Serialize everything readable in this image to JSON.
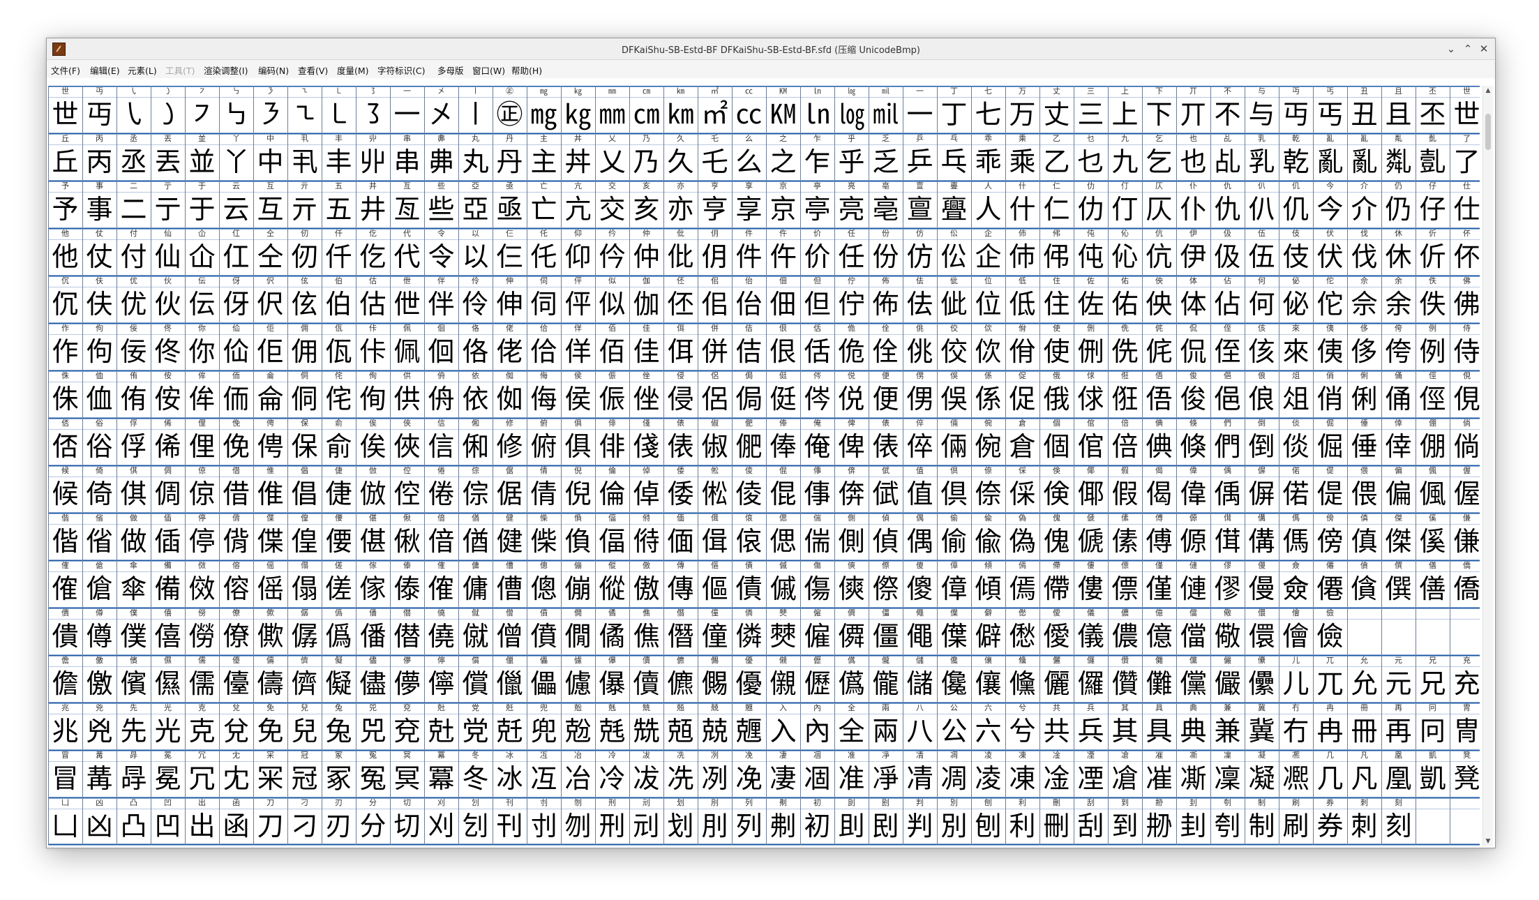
{
  "window": {
    "title": "DFKaiShu-SB-Estd-BF  DFKaiShu-SB-Estd-BF.sfd (压缩 UnicodeBmp)",
    "controls": {
      "minimize": "⌄",
      "maximize": "⌃",
      "close": "✕"
    }
  },
  "menubar": {
    "items": [
      "文件(F)",
      "编辑(E)",
      "元素(L)",
      "工具(T)",
      "渲染调整(I)",
      "编码(N)",
      "查看(V)",
      "度量(M)",
      "字符标识(C)",
      "多母版",
      "窗口(W)",
      "帮助(H)"
    ]
  },
  "grid": {
    "columns": 42,
    "line_color": "#1b57a6",
    "rows": [
      [
        "世",
        "丏",
        "㇂",
        "㇁",
        "㇇",
        "㇉",
        "㇋",
        "㇍",
        "㇄",
        "㇌",
        "一",
        "㐅",
        "㇑",
        "㊣",
        "㎎",
        "㎏",
        "㎜",
        "㎝",
        "㎞",
        "㎡",
        "㏄",
        "㏎",
        "㏑",
        "㏒",
        "㏕",
        "一",
        "丁",
        "七",
        "万",
        "丈",
        "三",
        "上",
        "下",
        "丌",
        "不",
        "与",
        "丏",
        "丐",
        "丑",
        "且",
        "丕",
        "世"
      ],
      [
        "丘",
        "丙",
        "丞",
        "丟",
        "並",
        "丫",
        "中",
        "丮",
        "丰",
        "丱",
        "串",
        "丳",
        "丸",
        "丹",
        "主",
        "丼",
        "乂",
        "乃",
        "久",
        "乇",
        "么",
        "之",
        "乍",
        "乎",
        "乏",
        "乒",
        "乓",
        "乖",
        "乘",
        "乙",
        "乜",
        "九",
        "乞",
        "也",
        "乩",
        "乳",
        "乾",
        "亂",
        "亂",
        "亃",
        "亄",
        "了"
      ],
      [
        "予",
        "事",
        "二",
        "亍",
        "于",
        "云",
        "互",
        "亓",
        "五",
        "井",
        "亙",
        "些",
        "亞",
        "亟",
        "亡",
        "亢",
        "交",
        "亥",
        "亦",
        "亨",
        "享",
        "京",
        "亭",
        "亮",
        "亳",
        "亶",
        "亹",
        "人",
        "什",
        "仁",
        "仂",
        "仃",
        "仄",
        "仆",
        "仇",
        "仈",
        "仉",
        "今",
        "介",
        "仍",
        "仔",
        "仕"
      ],
      [
        "他",
        "仗",
        "付",
        "仙",
        "仚",
        "仜",
        "仝",
        "仞",
        "仟",
        "仡",
        "代",
        "令",
        "以",
        "仨",
        "仛",
        "仰",
        "仱",
        "仲",
        "仳",
        "仴",
        "件",
        "仵",
        "价",
        "任",
        "份",
        "仿",
        "伀",
        "企",
        "伂",
        "伄",
        "伅",
        "伈",
        "伉",
        "伊",
        "伋",
        "伍",
        "伎",
        "伏",
        "伐",
        "休",
        "伒",
        "伓"
      ],
      [
        "伔",
        "伕",
        "优",
        "伙",
        "伝",
        "伢",
        "伬",
        "伭",
        "伯",
        "估",
        "伳",
        "伴",
        "伶",
        "伸",
        "伺",
        "伻",
        "似",
        "伽",
        "伾",
        "佀",
        "佁",
        "佃",
        "但",
        "佇",
        "佈",
        "佉",
        "佌",
        "位",
        "低",
        "住",
        "佐",
        "佑",
        "佒",
        "体",
        "佔",
        "何",
        "佖",
        "佗",
        "佘",
        "余",
        "佚",
        "佛"
      ],
      [
        "作",
        "佝",
        "佞",
        "佟",
        "你",
        "佡",
        "佢",
        "佣",
        "佤",
        "佧",
        "佩",
        "佪",
        "佫",
        "佬",
        "佮",
        "佯",
        "佰",
        "佳",
        "佴",
        "併",
        "佶",
        "佷",
        "佸",
        "佹",
        "佺",
        "佻",
        "佼",
        "佽",
        "佾",
        "使",
        "侀",
        "侁",
        "侂",
        "侃",
        "侄",
        "侅",
        "來",
        "侇",
        "侈",
        "侉",
        "例",
        "侍"
      ],
      [
        "侏",
        "侐",
        "侑",
        "侒",
        "侔",
        "侕",
        "侖",
        "侗",
        "侘",
        "侚",
        "供",
        "侜",
        "依",
        "侞",
        "侮",
        "侯",
        "侲",
        "侳",
        "侵",
        "侶",
        "侷",
        "侹",
        "侺",
        "侻",
        "便",
        "侽",
        "俁",
        "係",
        "促",
        "俄",
        "俅",
        "俇",
        "俉",
        "俊",
        "俋",
        "俍",
        "俎",
        "俏",
        "俐",
        "俑",
        "俓",
        "俔"
      ],
      [
        "俖",
        "俗",
        "俘",
        "俙",
        "俚",
        "俛",
        "俜",
        "保",
        "俞",
        "俟",
        "俠",
        "信",
        "俰",
        "修",
        "俯",
        "俱",
        "俳",
        "俴",
        "俵",
        "俶",
        "俷",
        "俸",
        "俺",
        "俾",
        "俵",
        "倅",
        "倆",
        "倇",
        "倉",
        "個",
        "倌",
        "倍",
        "倎",
        "倏",
        "們",
        "倒",
        "倓",
        "倔",
        "倕",
        "倖",
        "倗",
        "倘"
      ],
      [
        "候",
        "倚",
        "倛",
        "倜",
        "倞",
        "借",
        "倠",
        "倡",
        "倢",
        "倣",
        "倥",
        "倦",
        "倧",
        "倨",
        "倩",
        "倪",
        "倫",
        "倬",
        "倭",
        "倯",
        "倰",
        "倱",
        "倳",
        "倴",
        "倵",
        "值",
        "倶",
        "倷",
        "倸",
        "倹",
        "倻",
        "假",
        "偈",
        "偉",
        "偊",
        "偋",
        "偌",
        "偍",
        "偎",
        "偏",
        "偑",
        "偓"
      ],
      [
        "偕",
        "偗",
        "做",
        "偛",
        "停",
        "偝",
        "偞",
        "偟",
        "偠",
        "偡",
        "偢",
        "偣",
        "偤",
        "健",
        "偨",
        "偩",
        "偪",
        "偫",
        "偭",
        "偮",
        "偯",
        "偲",
        "偳",
        "側",
        "偵",
        "偶",
        "偷",
        "偸",
        "偽",
        "傀",
        "傂",
        "傃",
        "傅",
        "傆",
        "傇",
        "傋",
        "傌",
        "傍",
        "傎",
        "傑",
        "傒",
        "傔"
      ],
      [
        "傕",
        "傖",
        "傘",
        "備",
        "傚",
        "傛",
        "傜",
        "傝",
        "傞",
        "傢",
        "傣",
        "傕",
        "傭",
        "傮",
        "傯",
        "傰",
        "傱",
        "傲",
        "傳",
        "傴",
        "債",
        "傶",
        "傷",
        "傸",
        "傺",
        "傻",
        "傽",
        "傾",
        "傿",
        "僀",
        "僂",
        "僄",
        "僅",
        "僆",
        "僇",
        "僈",
        "僉",
        "僊",
        "僋",
        "僎",
        "僐",
        "僑"
      ],
      [
        "僓",
        "僔",
        "僕",
        "僖",
        "僗",
        "僚",
        "僛",
        "僝",
        "僞",
        "僠",
        "僣",
        "僥",
        "僦",
        "僧",
        "僨",
        "僩",
        "僪",
        "僬",
        "僭",
        "僮",
        "僯",
        "僰",
        "僱",
        "僲",
        "僵",
        "僶",
        "僷",
        "僻",
        "僽",
        "僾",
        "儀",
        "儂",
        "億",
        "儅",
        "儆",
        "儇",
        "儈",
        "儉"
      ],
      [
        "儋",
        "儌",
        "儐",
        "儑",
        "儒",
        "儓",
        "儔",
        "儕",
        "儗",
        "儘",
        "儚",
        "儜",
        "償",
        "儠",
        "儡",
        "儢",
        "儤",
        "儥",
        "儦",
        "儩",
        "優",
        "儭",
        "儮",
        "儰",
        "儱",
        "儲",
        "儳",
        "儴",
        "儵",
        "儷",
        "儸",
        "儹",
        "儺",
        "儻",
        "儼",
        "儽",
        "儿",
        "兀",
        "允",
        "元",
        "兄",
        "充"
      ],
      [
        "兆",
        "兇",
        "先",
        "光",
        "克",
        "兌",
        "免",
        "兒",
        "兔",
        "兕",
        "兗",
        "兙",
        "党",
        "兛",
        "兜",
        "兝",
        "兞",
        "兟",
        "兡",
        "兢",
        "兣",
        "入",
        "內",
        "全",
        "兩",
        "八",
        "公",
        "六",
        "兮",
        "共",
        "兵",
        "其",
        "具",
        "典",
        "兼",
        "冀",
        "冇",
        "冉",
        "冊",
        "再",
        "冋",
        "冑"
      ],
      [
        "冒",
        "冓",
        "冔",
        "冕",
        "冗",
        "冘",
        "冞",
        "冠",
        "冢",
        "冤",
        "冥",
        "冪",
        "冬",
        "冰",
        "冱",
        "冶",
        "冷",
        "冹",
        "冼",
        "冽",
        "凂",
        "凄",
        "凅",
        "准",
        "凈",
        "凊",
        "凋",
        "凌",
        "凍",
        "凎",
        "凐",
        "凔",
        "凗",
        "凘",
        "凜",
        "凝",
        "凞",
        "几",
        "凡",
        "凰",
        "凱",
        "凳"
      ],
      [
        "凵",
        "凶",
        "凸",
        "凹",
        "出",
        "函",
        "刀",
        "刁",
        "刃",
        "分",
        "切",
        "刈",
        "刉",
        "刊",
        "刌",
        "刎",
        "刑",
        "刓",
        "划",
        "刖",
        "列",
        "刜",
        "初",
        "刞",
        "刡",
        "判",
        "別",
        "刨",
        "利",
        "刪",
        "刮",
        "到",
        "刱",
        "刲",
        "刳",
        "制",
        "刷",
        "券",
        "刺",
        "刻"
      ]
    ]
  }
}
